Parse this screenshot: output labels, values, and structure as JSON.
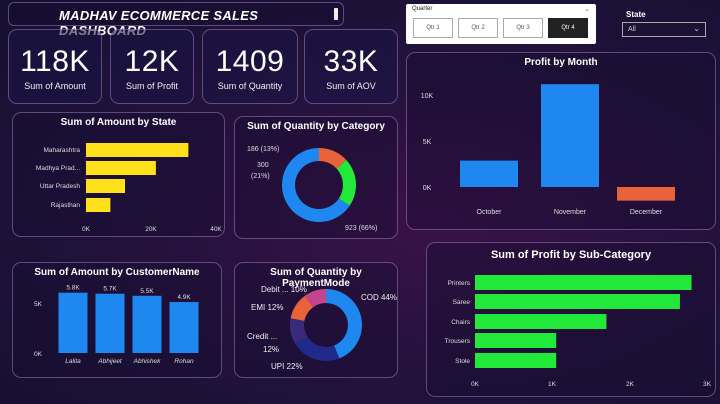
{
  "header": {
    "title": "MADHAV ECOMMERCE SALES DASHBOARD"
  },
  "kpis": [
    {
      "value": "118K",
      "label": "Sum of Amount"
    },
    {
      "value": "12K",
      "label": "Sum of Profit"
    },
    {
      "value": "1409",
      "label": "Sum of Quantity"
    },
    {
      "value": "33K",
      "label": "Sum of AOV"
    }
  ],
  "quarter_slicer": {
    "header": "Quarter",
    "options": [
      "Qtr 1",
      "Qtr 2",
      "Qtr 3",
      "Qtr 4"
    ],
    "selected": "Qtr 4"
  },
  "state_slicer": {
    "label": "State",
    "value": "All"
  },
  "colors": {
    "yellow": "#ffe11b",
    "blue": "#1e88f0",
    "green": "#22e83a",
    "orange": "#e8623a",
    "navy": "#202a8a",
    "pink": "#c6448e"
  },
  "chart_data": [
    {
      "type": "bar",
      "title": "Profit by Month",
      "categories": [
        "October",
        "November",
        "December"
      ],
      "values": [
        2900,
        11300,
        -1500
      ],
      "colors": [
        "#1e88f0",
        "#1e88f0",
        "#e8623a"
      ],
      "yticks": [
        "10K",
        "5K",
        "0K"
      ],
      "ylim": [
        -2000,
        10000
      ]
    },
    {
      "type": "bar",
      "orientation": "horizontal",
      "title": "Sum of Amount by State",
      "categories": [
        "Maharashtra",
        "Madhya Prad...",
        "Uttar Pradesh",
        "Rajasthan"
      ],
      "values": [
        31500,
        21500,
        12000,
        7500
      ],
      "xticks": [
        "0K",
        "20K",
        "40K"
      ],
      "xlim": [
        0,
        40000
      ]
    },
    {
      "type": "pie",
      "title": "Sum of Quantity by Category",
      "labels": [
        "186 (13%)",
        "300 (21%)",
        "923 (66%)"
      ],
      "values": [
        186,
        300,
        923
      ],
      "colors": [
        "#e8623a",
        "#22e83a",
        "#1e88f0"
      ]
    },
    {
      "type": "bar",
      "title": "Sum of Amount by CustomerName",
      "categories": [
        "Lalita",
        "Abhijeet",
        "Abhishek",
        "Rohan"
      ],
      "values": [
        5800,
        5700,
        5500,
        4900
      ],
      "data_labels": [
        "5.8K",
        "5.7K",
        "5.5K",
        "4.9K"
      ],
      "yticks": [
        "5K",
        "0K"
      ],
      "ylim": [
        0,
        6000
      ]
    },
    {
      "type": "pie",
      "title": "Sum of Quantity by PaymentMode",
      "labels": [
        "COD 44%",
        "UPI 22%",
        "Credit ...",
        "12%",
        "EMI 12%",
        "Debit ... 10%"
      ],
      "slices": [
        {
          "name": "COD",
          "value": 44,
          "color": "#1e88f0"
        },
        {
          "name": "UPI",
          "value": 22,
          "color": "#202a8a"
        },
        {
          "name": "Credit",
          "value": 12,
          "color": "#3a2a7a"
        },
        {
          "name": "EMI",
          "value": 12,
          "color": "#e8623a"
        },
        {
          "name": "Debit",
          "value": 10,
          "color": "#c6448e"
        }
      ]
    },
    {
      "type": "bar",
      "orientation": "horizontal",
      "title": "Sum of Profit by Sub-Category",
      "categories": [
        "Printers",
        "Saree",
        "Chairs",
        "Trousers",
        "Stole"
      ],
      "values": [
        2800,
        2650,
        1700,
        1050,
        1050
      ],
      "xticks": [
        "0K",
        "1K",
        "2K",
        "3K"
      ],
      "xlim": [
        0,
        3000
      ]
    }
  ]
}
